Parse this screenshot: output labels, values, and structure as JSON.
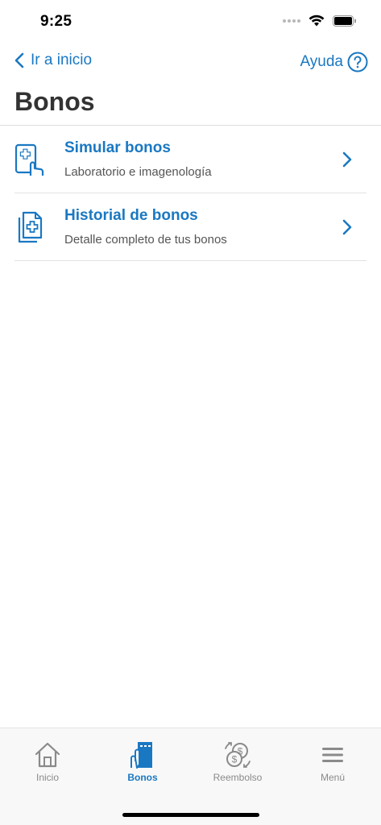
{
  "status_bar": {
    "time": "9:25"
  },
  "nav": {
    "back_label": "Ir a inicio",
    "help_label": "Ayuda"
  },
  "page": {
    "title": "Bonos"
  },
  "menu": {
    "items": [
      {
        "title": "Simular bonos",
        "subtitle": "Laboratorio e imagenología",
        "icon": "tablet-medical-hand-icon"
      },
      {
        "title": "Historial de bonos",
        "subtitle": "Detalle completo de tus bonos",
        "icon": "medical-documents-icon"
      }
    ]
  },
  "tab_bar": {
    "tabs": [
      {
        "label": "Inicio",
        "icon": "home-icon",
        "active": false
      },
      {
        "label": "Bonos",
        "icon": "bonos-icon",
        "active": true
      },
      {
        "label": "Reembolso",
        "icon": "reimbursement-icon",
        "active": false
      },
      {
        "label": "Menú",
        "icon": "menu-icon",
        "active": false
      }
    ]
  },
  "colors": {
    "accent": "#1a78c2",
    "text": "#333333",
    "inactive_tab": "#8a8a8a"
  }
}
